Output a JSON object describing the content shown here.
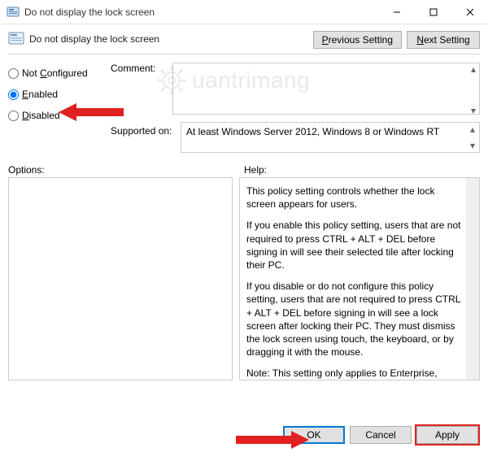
{
  "window": {
    "title": "Do not display the lock screen"
  },
  "header": {
    "heading": "Do not display the lock screen",
    "prev": "Previous Setting",
    "next": "Next Setting"
  },
  "radios": {
    "not_configured": {
      "label_pre": "Not ",
      "u": "C",
      "label_post": "onfigured"
    },
    "enabled": {
      "u": "E",
      "label_post": "nabled"
    },
    "disabled": {
      "u": "D",
      "label_post": "isabled"
    }
  },
  "labels": {
    "comment": "Comment:",
    "supported": "Supported on:",
    "options": "Options:",
    "help": "Help:"
  },
  "supported_text": "At least Windows Server 2012, Windows 8 or Windows RT",
  "help": {
    "p1": "This policy setting controls whether the lock screen appears for users.",
    "p2": "If you enable this policy setting, users that are not required to press CTRL + ALT + DEL before signing in will see their selected tile after locking their PC.",
    "p3": "If you disable or do not configure this policy setting, users that are not required to press CTRL + ALT + DEL before signing in will see a lock screen after locking their PC. They must dismiss the lock screen using touch, the keyboard, or by dragging it with the mouse.",
    "p4": "Note: This setting only applies to Enterprise, Education, and Server SKUs."
  },
  "buttons": {
    "ok": "OK",
    "cancel": "Cancel",
    "apply": "Apply"
  },
  "watermark": "uantrimang"
}
